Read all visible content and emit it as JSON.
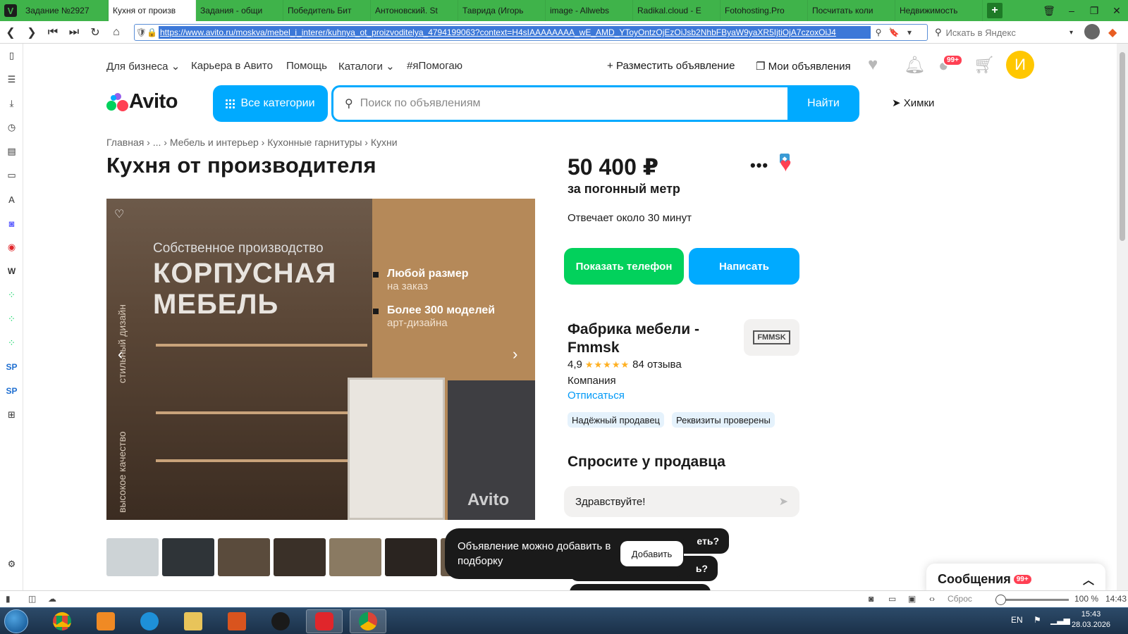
{
  "browser": {
    "tabs": [
      {
        "label": "Задание №2927",
        "fav_color": "#3fb34a",
        "fav_letter": "P"
      },
      {
        "label": "Кухня от произв",
        "fav_color": "#00aaff",
        "fav_letter": "•"
      },
      {
        "label": "Задания - общи",
        "fav_color": "#3fb34a",
        "fav_letter": "P"
      },
      {
        "label": "Победитель Бит",
        "fav_color": "#0077ff",
        "fav_letter": "vk"
      },
      {
        "label": "Антоновский. St",
        "fav_color": "#ffffff",
        "fav_letter": "▢"
      },
      {
        "label": "Таврида (Игорь",
        "fav_color": "#7ea55a",
        "fav_letter": "▪"
      },
      {
        "label": "image - Allwebs",
        "fav_color": "#3a7bd5",
        "fav_letter": "◉"
      },
      {
        "label": "Radikal.cloud - E",
        "fav_color": "#222222",
        "fav_letter": "R"
      },
      {
        "label": "Fotohosting.Pro",
        "fav_color": "#f2b300",
        "fav_letter": "F"
      },
      {
        "label": "Посчитать коли",
        "fav_color": "#1a3fd8",
        "fav_letter": "●"
      },
      {
        "label": "Недвижимость",
        "fav_color": "#3a9bd5",
        "fav_letter": "◆"
      }
    ],
    "url": "https://www.avito.ru/moskva/mebel_i_interer/kuhnya_ot_proizvoditelya_4794199063?context=H4sIAAAAAAAA_wE_AMD_YToyOntzOjEzOiJsb2NhbFByaW9yaXR5IjtiOjA7czoxOiJ4",
    "search_placeholder": "Искать в Яндекс",
    "status": {
      "reset": "Сброс",
      "zoom": "100 %",
      "time": "14:43"
    }
  },
  "header": {
    "nav": [
      "Для бизнеса",
      "Карьера в Авито",
      "Помощь",
      "Каталоги",
      "#яПомогаю"
    ],
    "post_ad": "Разместить объявление",
    "my_ads": "Мои объявления",
    "messages_badge": "99+",
    "avatar_letter": "И",
    "logo": "Avito",
    "categories": "Все категории",
    "search_placeholder": "Поиск по объявлениям",
    "find": "Найти",
    "location": "Химки"
  },
  "breadcrumbs": "Главная › ... › Мебель и интерьер › Кухонные гарнитуры › Кухни",
  "title": "Кухня от производителя",
  "photo": {
    "subtitle": "Собственное производство",
    "headline_1": "КОРПУСНАЯ",
    "headline_2": "МЕБЕЛЬ",
    "feature_1": "Любой размер",
    "feature_1_sub": "на заказ",
    "feature_2": "Более 300 моделей",
    "feature_2_sub": "арт-дизайна",
    "vertical_1": "стильный дизайн",
    "vertical_2": "высокое качество",
    "watermark": "Avito"
  },
  "thumb_colors": [
    "#cdd3d6",
    "#2f3438",
    "#5a4b3c",
    "#3a3028",
    "#8a7a62",
    "#2a2420",
    "#6a5a48"
  ],
  "listing": {
    "price": "50 400 ₽",
    "unit": "за погонный метр",
    "response": "Отвечает около 30 минут",
    "show_phone": "Показать телефон",
    "write": "Написать"
  },
  "seller": {
    "name": "Фабрика мебели - Fmmsk",
    "logo_text": "FMMSK",
    "rating": "4,9",
    "reviews": "84 отзыва",
    "type": "Компания",
    "unsubscribe": "Отписаться",
    "tags": [
      "Надёжный продавец",
      "Реквизиты проверены"
    ]
  },
  "ask": {
    "title": "Спросите у продавца",
    "message": "Здравствуйте!",
    "chip_1": "еть?",
    "chip_2": "ь?"
  },
  "toast": {
    "text": "Объявление можно добавить в подборку",
    "button": "Добавить"
  },
  "messages_panel": {
    "title": "Сообщения",
    "badge": "99+"
  },
  "taskbar": {
    "lang": "EN",
    "time": "15:43",
    "date": "28.03.2026"
  }
}
